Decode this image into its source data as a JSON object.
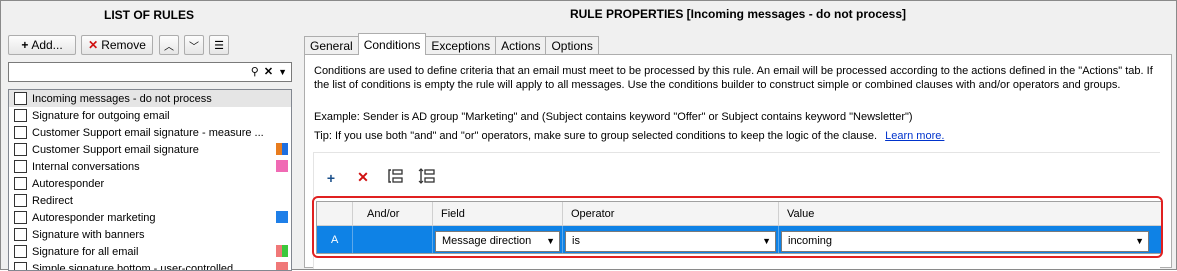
{
  "left": {
    "title": "LIST OF RULES",
    "buttons": {
      "add": "Add...",
      "remove": "Remove"
    },
    "rules": [
      {
        "label": "Incoming messages - do not process",
        "selected": true,
        "colors": []
      },
      {
        "label": "Signature for outgoing email",
        "colors": []
      },
      {
        "label": "Customer Support email signature - measure ...",
        "colors": []
      },
      {
        "label": "Customer Support  email signature",
        "colors": [
          "#e87c1e",
          "#1e6fe0"
        ]
      },
      {
        "label": "Internal conversations",
        "colors": [
          "#f06ab4"
        ]
      },
      {
        "label": "Autoresponder",
        "colors": []
      },
      {
        "label": "Redirect",
        "colors": []
      },
      {
        "label": "Autoresponder marketing",
        "colors": [
          "#1e7fe8"
        ]
      },
      {
        "label": "Signature with banners",
        "colors": []
      },
      {
        "label": "Signature for all email",
        "colors": [
          "#f07878",
          "#3cc83c"
        ]
      },
      {
        "label": "Simple  signature bottom - user-controlled",
        "colors": [
          "#f07878"
        ]
      }
    ]
  },
  "right": {
    "title": "RULE PROPERTIES [Incoming messages - do not process]",
    "tabs": [
      "General",
      "Conditions",
      "Exceptions",
      "Actions",
      "Options"
    ],
    "active_tab": "Conditions",
    "description": "Conditions are used to define criteria that an email must meet to be processed by this rule. An email will be processed according to the actions defined in the \"Actions\" tab. If the list of conditions is empty the rule will apply to all messages. Use the conditions builder to construct simple or combined clauses with and/or operators and groups.",
    "example": "Example: Sender is AD group \"Marketing\" and (Subject contains keyword \"Offer\" or Subject contains keyword \"Newsletter\")",
    "tip": "Tip: If you use both \"and\" and \"or\" operators, make sure to group selected conditions to keep the logic of the clause.",
    "learn_more": "Learn more.",
    "grid": {
      "headers": [
        "",
        "And/or",
        "Field",
        "Operator",
        "Value"
      ],
      "row": {
        "id": "A",
        "andor": "",
        "field": "Message direction",
        "operator": "is",
        "value": "incoming"
      }
    }
  },
  "colors": {
    "selection_blue": "#0e82e6",
    "highlight_red": "#e02020",
    "link": "#0033cc"
  }
}
